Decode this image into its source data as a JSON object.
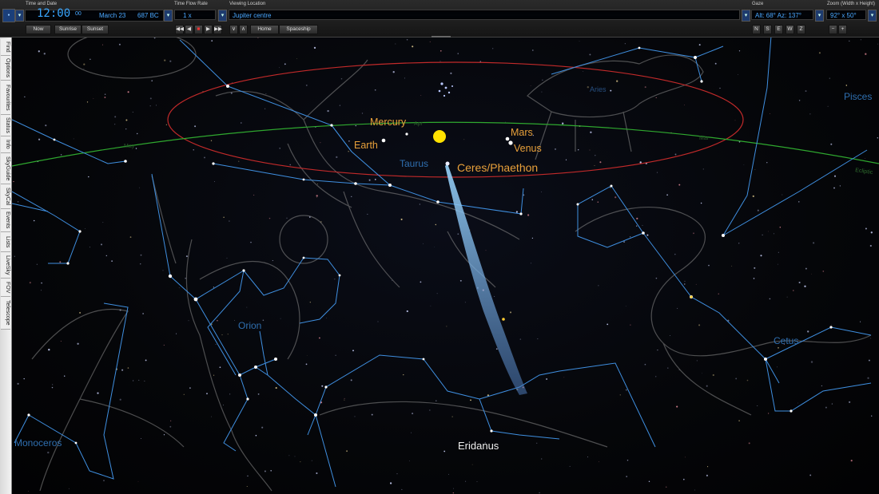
{
  "toolbar": {
    "time_group_label": "Time and Date",
    "time": "12:00",
    "seconds": "00",
    "date": "March 23",
    "year": "687 BC",
    "now_label": "Now",
    "sunrise_label": "Sunrise",
    "sunset_label": "Sunset",
    "flow_group_label": "Time Flow Rate",
    "flow_rate": "1 x",
    "location_group_label": "Viewing Location",
    "location": "Jupiter centre",
    "home_label": "Home",
    "spaceship_label": "Spaceship",
    "gaze_group_label": "Gaze",
    "gaze": "Alt: 68° Az: 137°",
    "dir_buttons": [
      "N",
      "S",
      "E",
      "W",
      "Z"
    ],
    "zoom_group_label": "Zoom (Width x Height)",
    "zoom": "92° x 50°"
  },
  "sidebar": {
    "tabs": [
      "Find",
      "Options",
      "Favourites",
      "Status",
      "Info",
      "SkyGuide",
      "SkyCal",
      "Events",
      "Lists",
      "LiveSky",
      "FOV",
      "Telescope"
    ]
  },
  "sky": {
    "planets": {
      "mercury": "Mercury",
      "earth": "Earth",
      "mars": "Mars",
      "venus": "Venus",
      "ceres": "Ceres/Phaethon"
    },
    "constellations": {
      "taurus": "Taurus",
      "orion": "Orion",
      "eridanus": "Eridanus",
      "pisces": "Pisces",
      "cetus": "Cetus",
      "monoceros": "Monoceros",
      "aries": "Aries"
    },
    "small_labels": {
      "ecliptic": "Ecliptic",
      "apr": "Apr",
      "mar": "Mar",
      "may": "May"
    },
    "colors": {
      "planet_label": "#e8a03a",
      "sun": "#ffe200",
      "ecliptic": "#2fa82f",
      "orbit": "#c22a2a",
      "constellation_line": "#3f8fe0",
      "constellation_label": "#2f6fb0"
    }
  }
}
